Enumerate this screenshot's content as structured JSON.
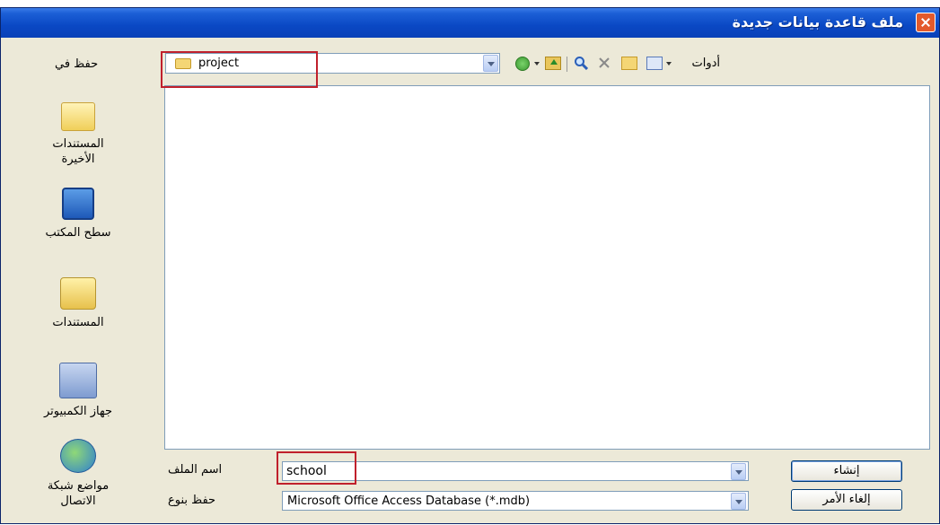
{
  "window": {
    "title": "ملف قاعدة بيانات جديدة"
  },
  "save_in": {
    "label": "حفظ في",
    "folder": "project"
  },
  "toolbar": {
    "tools_label": "أدوات"
  },
  "places": [
    {
      "label_line1": "المستندات",
      "label_line2": "الأخيرة"
    },
    {
      "label_line1": "سطح المكتب",
      "label_line2": ""
    },
    {
      "label_line1": "المستندات",
      "label_line2": ""
    },
    {
      "label_line1": "جهاز الكمبيوتر",
      "label_line2": ""
    },
    {
      "label_line1": "مواضع شبكة",
      "label_line2": "الاتصال"
    }
  ],
  "file_name": {
    "label": "اسم الملف",
    "value": "school"
  },
  "file_type": {
    "label": "حفظ بنوع",
    "value": "Microsoft Office Access Database (*.mdb)"
  },
  "buttons": {
    "create": "إنشاء",
    "cancel": "إلغاء الأمر"
  }
}
